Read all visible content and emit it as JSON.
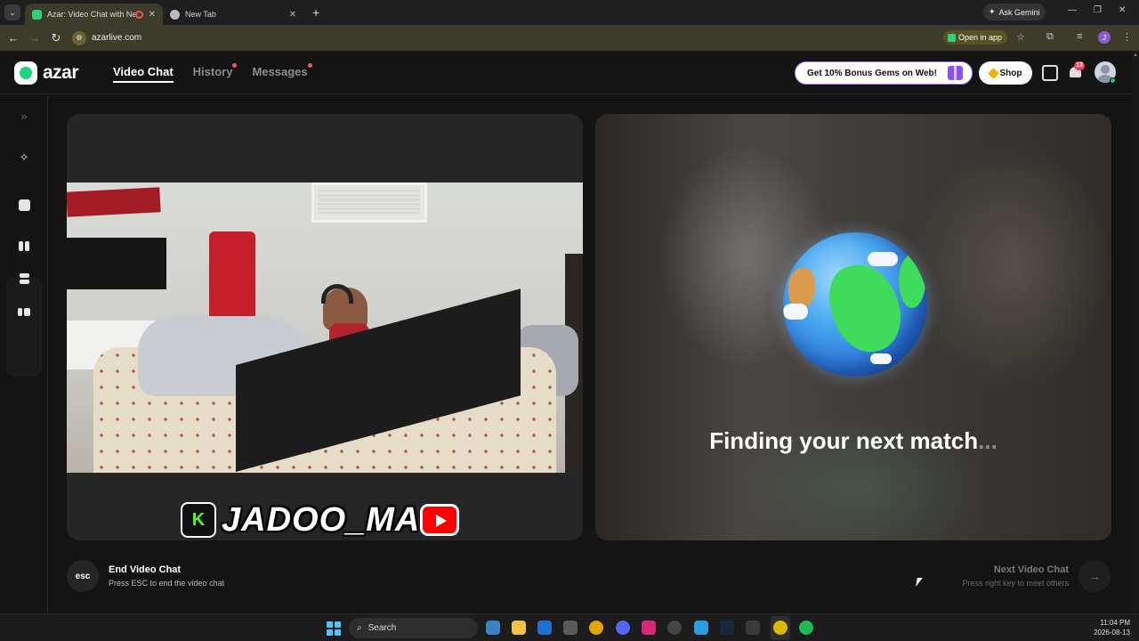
{
  "browser": {
    "tabs": [
      {
        "title": "Azar: Video Chat with New",
        "active": true
      },
      {
        "title": "New Tab",
        "active": false
      }
    ],
    "gemini_label": "Ask Gemini",
    "url": "azarlive.com",
    "open_in_app_label": "Open in app",
    "profile_initial": "J"
  },
  "app": {
    "logo_text": "azar",
    "nav": [
      {
        "label": "Video Chat",
        "active": true,
        "dot": false
      },
      {
        "label": "History",
        "active": false,
        "dot": true
      },
      {
        "label": "Messages",
        "active": false,
        "dot": true
      }
    ],
    "bonus_label": "Get 10% Bonus Gems on Web!",
    "shop_label": "Shop",
    "notification_count": "13",
    "colors": {
      "brand": "#1bd47b",
      "accent_purple": "#8a4dff",
      "badge": "#ff3b5c"
    }
  },
  "left_panel": {
    "watermark": "JADOO_MA"
  },
  "right_panel": {
    "status_text": "Finding your next match",
    "status_dots": "..."
  },
  "footer": {
    "esc_label": "esc",
    "end_title": "End Video Chat",
    "end_subtitle": "Press ESC to end the video chat",
    "next_title": "Next Video Chat",
    "next_subtitle": "Press right key to meet others"
  },
  "taskbar": {
    "search_placeholder": "Search",
    "time": "11:04 PM",
    "date": "2026-08-13"
  }
}
